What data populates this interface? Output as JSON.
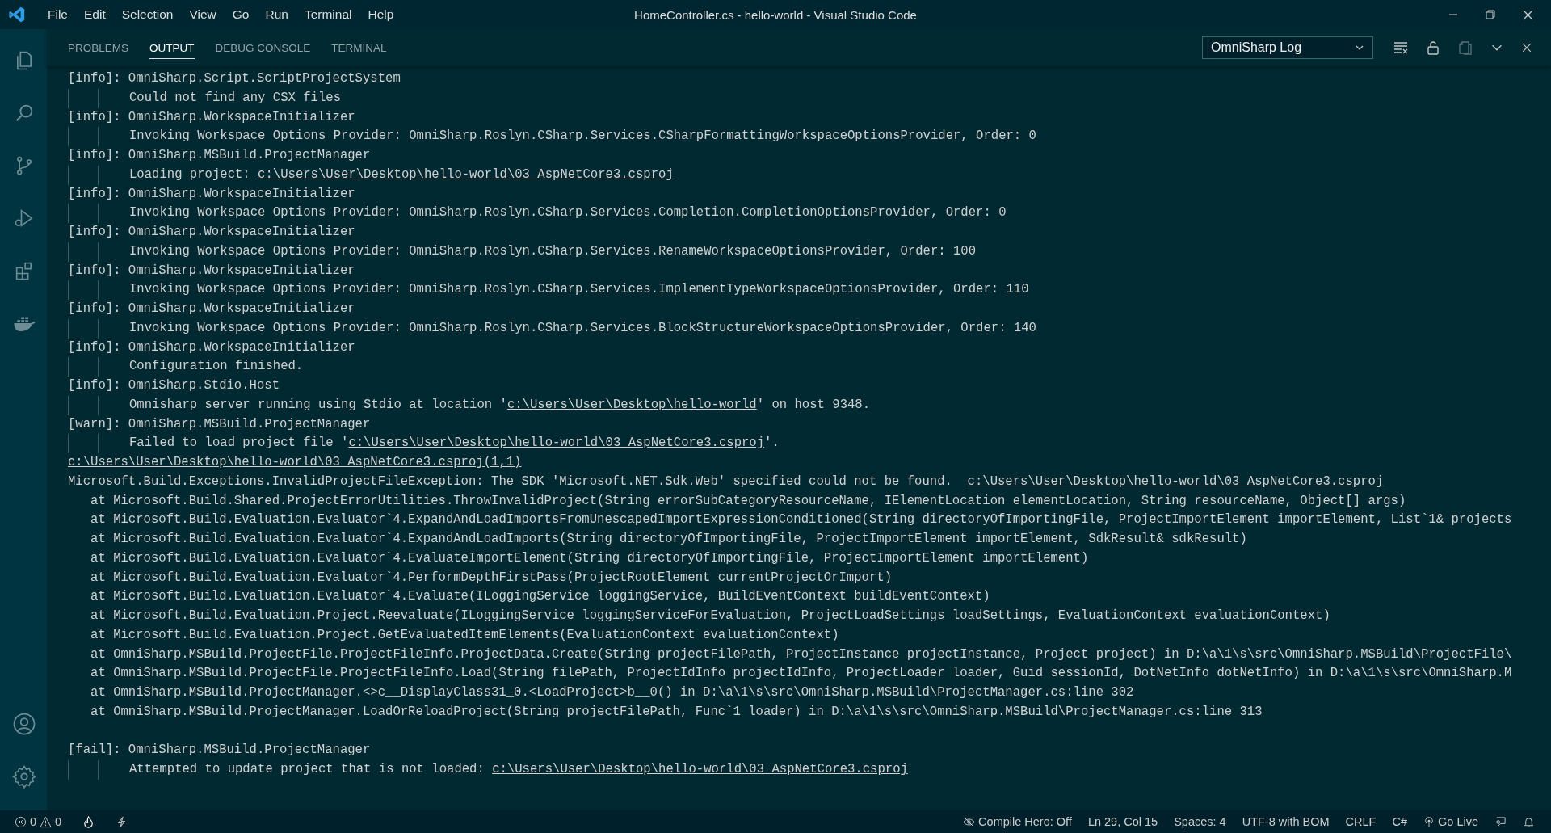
{
  "window": {
    "title": "HomeController.cs - hello-world - Visual Studio Code"
  },
  "menu": [
    "File",
    "Edit",
    "Selection",
    "View",
    "Go",
    "Run",
    "Terminal",
    "Help"
  ],
  "activity_bar": [
    {
      "kind": "files",
      "selected": false
    },
    {
      "kind": "search",
      "selected": false
    },
    {
      "kind": "source-control",
      "selected": false
    },
    {
      "kind": "run",
      "selected": false
    },
    {
      "kind": "extensions",
      "selected": false
    },
    {
      "kind": "docker",
      "selected": false
    }
  ],
  "activity_bar_bottom": [
    {
      "kind": "account"
    },
    {
      "kind": "settings"
    }
  ],
  "panel": {
    "tabs": [
      {
        "label": "PROBLEMS",
        "selected": false
      },
      {
        "label": "OUTPUT",
        "selected": true
      },
      {
        "label": "DEBUG CONSOLE",
        "selected": false
      },
      {
        "label": "TERMINAL",
        "selected": false
      }
    ],
    "channel": "OmniSharp Log",
    "actions": [
      {
        "kind": "clear",
        "disabled": false
      },
      {
        "kind": "lock",
        "disabled": false
      },
      {
        "kind": "copy",
        "disabled": true
      },
      {
        "kind": "collapse",
        "disabled": false
      },
      {
        "kind": "close",
        "disabled": false
      }
    ],
    "lines": [
      {
        "kind": "header",
        "text": "[info]: OmniSharp.Script.ScriptProjectSystem"
      },
      {
        "kind": "detail",
        "text": "Could not find any CSX files"
      },
      {
        "kind": "header",
        "text": "[info]: OmniSharp.WorkspaceInitializer"
      },
      {
        "kind": "detail",
        "text": "Invoking Workspace Options Provider: OmniSharp.Roslyn.CSharp.Services.CSharpFormattingWorkspaceOptionsProvider, Order: 0"
      },
      {
        "kind": "header",
        "text": "[info]: OmniSharp.MSBuild.ProjectManager"
      },
      {
        "kind": "detail",
        "text": "Loading project: ",
        "link": "c:\\Users\\User\\Desktop\\hello-world\\03_AspNetCore3.csproj"
      },
      {
        "kind": "header",
        "text": "[info]: OmniSharp.WorkspaceInitializer"
      },
      {
        "kind": "detail",
        "text": "Invoking Workspace Options Provider: OmniSharp.Roslyn.CSharp.Services.Completion.CompletionOptionsProvider, Order: 0"
      },
      {
        "kind": "header",
        "text": "[info]: OmniSharp.WorkspaceInitializer"
      },
      {
        "kind": "detail",
        "text": "Invoking Workspace Options Provider: OmniSharp.Roslyn.CSharp.Services.RenameWorkspaceOptionsProvider, Order: 100"
      },
      {
        "kind": "header",
        "text": "[info]: OmniSharp.WorkspaceInitializer"
      },
      {
        "kind": "detail",
        "text": "Invoking Workspace Options Provider: OmniSharp.Roslyn.CSharp.Services.ImplementTypeWorkspaceOptionsProvider, Order: 110"
      },
      {
        "kind": "header",
        "text": "[info]: OmniSharp.WorkspaceInitializer"
      },
      {
        "kind": "detail",
        "text": "Invoking Workspace Options Provider: OmniSharp.Roslyn.CSharp.Services.BlockStructureWorkspaceOptionsProvider, Order: 140"
      },
      {
        "kind": "header",
        "text": "[info]: OmniSharp.WorkspaceInitializer"
      },
      {
        "kind": "detail",
        "text": "Configuration finished."
      },
      {
        "kind": "header",
        "text": "[info]: OmniSharp.Stdio.Host"
      },
      {
        "kind": "detail",
        "text": "Omnisharp server running using Stdio at location '",
        "link": "c:\\Users\\User\\Desktop\\hello-world",
        "after": "' on host 9348."
      },
      {
        "kind": "header",
        "text": "[warn]: OmniSharp.MSBuild.ProjectManager"
      },
      {
        "kind": "detail",
        "text": "Failed to load project file '",
        "link": "c:\\Users\\User\\Desktop\\hello-world\\03_AspNetCore3.csproj",
        "after": "'."
      },
      {
        "kind": "plain",
        "link": "c:\\Users\\User\\Desktop\\hello-world\\03_AspNetCore3.csproj(1,1)"
      },
      {
        "kind": "plain",
        "text": "Microsoft.Build.Exceptions.InvalidProjectFileException: The SDK 'Microsoft.NET.Sdk.Web' specified could not be found.  ",
        "link": "c:\\Users\\User\\Desktop\\hello-world\\03_AspNetCore3.csproj"
      },
      {
        "kind": "plain",
        "text": "   at Microsoft.Build.Shared.ProjectErrorUtilities.ThrowInvalidProject(String errorSubCategoryResourceName, IElementLocation elementLocation, String resourceName, Object[] args)"
      },
      {
        "kind": "plain",
        "text": "   at Microsoft.Build.Evaluation.Evaluator`4.ExpandAndLoadImportsFromUnescapedImportExpressionConditioned(String directoryOfImportingFile, ProjectImportElement importElement, List`1& projects"
      },
      {
        "kind": "plain",
        "text": "   at Microsoft.Build.Evaluation.Evaluator`4.ExpandAndLoadImports(String directoryOfImportingFile, ProjectImportElement importElement, SdkResult& sdkResult)"
      },
      {
        "kind": "plain",
        "text": "   at Microsoft.Build.Evaluation.Evaluator`4.EvaluateImportElement(String directoryOfImportingFile, ProjectImportElement importElement)"
      },
      {
        "kind": "plain",
        "text": "   at Microsoft.Build.Evaluation.Evaluator`4.PerformDepthFirstPass(ProjectRootElement currentProjectOrImport)"
      },
      {
        "kind": "plain",
        "text": "   at Microsoft.Build.Evaluation.Evaluator`4.Evaluate(ILoggingService loggingService, BuildEventContext buildEventContext)"
      },
      {
        "kind": "plain",
        "text": "   at Microsoft.Build.Evaluation.Project.Reevaluate(ILoggingService loggingServiceForEvaluation, ProjectLoadSettings loadSettings, EvaluationContext evaluationContext)"
      },
      {
        "kind": "plain",
        "text": "   at Microsoft.Build.Evaluation.Project.GetEvaluatedItemElements(EvaluationContext evaluationContext)"
      },
      {
        "kind": "plain",
        "text": "   at OmniSharp.MSBuild.ProjectFile.ProjectFileInfo.ProjectData.Create(String projectFilePath, ProjectInstance projectInstance, Project project) in D:\\a\\1\\s\\src\\OmniSharp.MSBuild\\ProjectFile\\"
      },
      {
        "kind": "plain",
        "text": "   at OmniSharp.MSBuild.ProjectFile.ProjectFileInfo.Load(String filePath, ProjectIdInfo projectIdInfo, ProjectLoader loader, Guid sessionId, DotNetInfo dotNetInfo) in D:\\a\\1\\s\\src\\OmniSharp.M"
      },
      {
        "kind": "plain",
        "text": "   at OmniSharp.MSBuild.ProjectManager.<>c__DisplayClass31_0.<LoadProject>b__0() in D:\\a\\1\\s\\src\\OmniSharp.MSBuild\\ProjectManager.cs:line 302"
      },
      {
        "kind": "plain",
        "text": "   at OmniSharp.MSBuild.ProjectManager.LoadOrReloadProject(String projectFilePath, Func`1 loader) in D:\\a\\1\\s\\src\\OmniSharp.MSBuild\\ProjectManager.cs:line 313"
      },
      {
        "kind": "blank"
      },
      {
        "kind": "header",
        "text": "[fail]: OmniSharp.MSBuild.ProjectManager"
      },
      {
        "kind": "detail",
        "text": "Attempted to update project that is not loaded: ",
        "link": "c:\\Users\\User\\Desktop\\hello-world\\03_AspNetCore3.csproj"
      }
    ]
  },
  "status_bar": {
    "errors": "0",
    "warnings": "0",
    "right": [
      {
        "kind": "compile-hero",
        "text": "Compile Hero: Off"
      },
      {
        "kind": "text",
        "text": "Ln 29, Col 15"
      },
      {
        "kind": "text",
        "text": "Spaces: 4"
      },
      {
        "kind": "text",
        "text": "UTF-8 with BOM"
      },
      {
        "kind": "text",
        "text": "CRLF"
      },
      {
        "kind": "text",
        "text": "C#"
      },
      {
        "kind": "live",
        "text": "Go Live"
      },
      {
        "kind": "feedback"
      },
      {
        "kind": "bell"
      }
    ]
  }
}
